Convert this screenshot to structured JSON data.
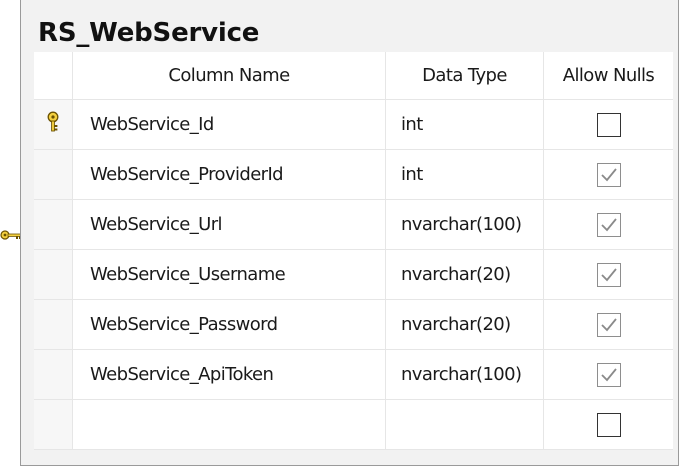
{
  "table": {
    "title": "RS_WebService",
    "headers": {
      "name": "Column Name",
      "type": "Data Type",
      "nulls": "Allow Nulls"
    },
    "rows": [
      {
        "name": "WebService_Id",
        "type": "int",
        "allow_nulls": false,
        "primary_key": true
      },
      {
        "name": "WebService_ProviderId",
        "type": "int",
        "allow_nulls": true,
        "primary_key": false
      },
      {
        "name": "WebService_Url",
        "type": "nvarchar(100)",
        "allow_nulls": true,
        "primary_key": false
      },
      {
        "name": "WebService_Username",
        "type": "nvarchar(20)",
        "allow_nulls": true,
        "primary_key": false
      },
      {
        "name": "WebService_Password",
        "type": "nvarchar(20)",
        "allow_nulls": true,
        "primary_key": false
      },
      {
        "name": "WebService_ApiToken",
        "type": "nvarchar(100)",
        "allow_nulls": true,
        "primary_key": false
      },
      {
        "name": "",
        "type": "",
        "allow_nulls": false,
        "primary_key": false
      }
    ]
  },
  "icons": {
    "primary_key": "key-icon",
    "relationship": "relationship-key-icon"
  },
  "colors": {
    "key": "#e8b90a",
    "panel": "#f2f2f2",
    "grid_line": "#e6e6e6"
  }
}
